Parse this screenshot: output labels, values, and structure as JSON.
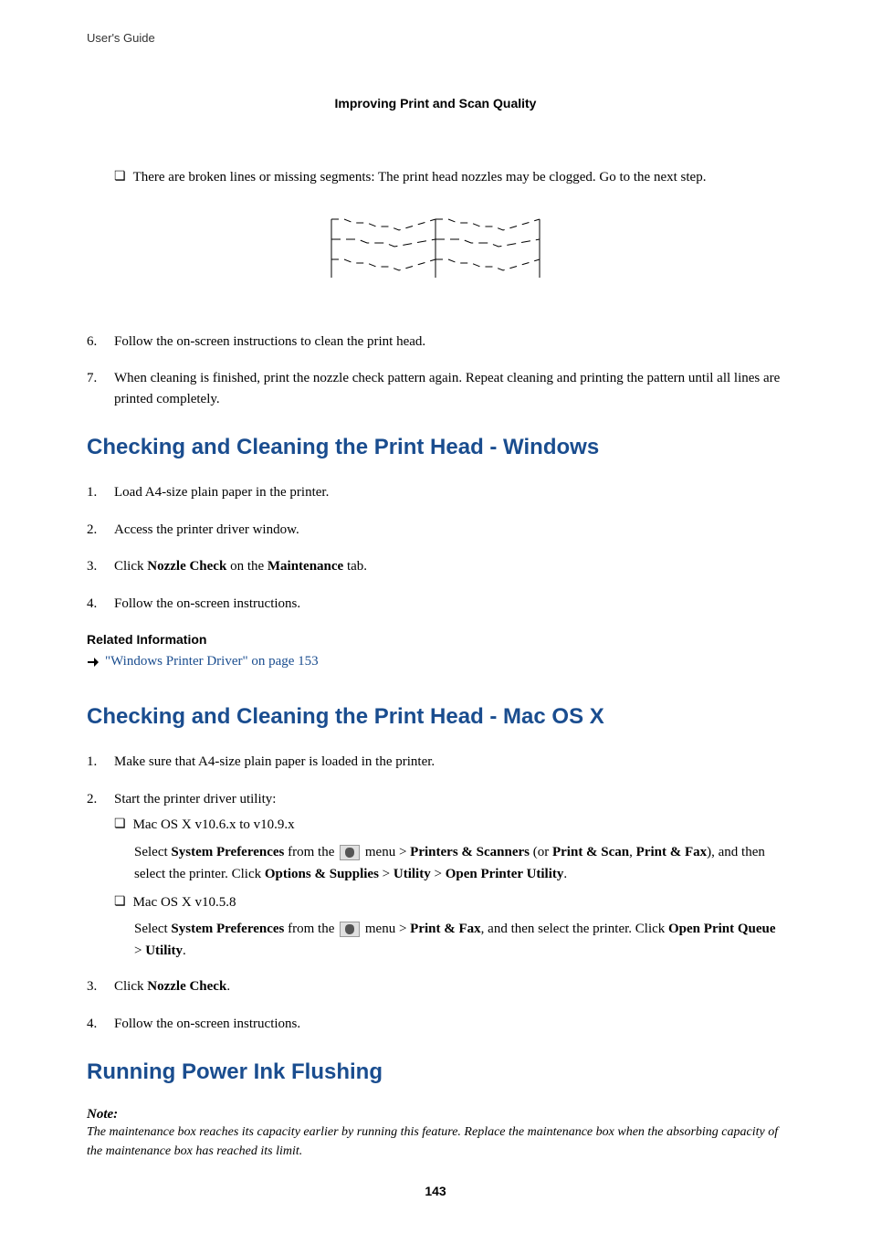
{
  "guide_label": "User's Guide",
  "section_header": "Improving Print and Scan Quality",
  "broken_lines_bullet": "There are broken lines or missing segments: The print head nozzles may be clogged. Go to the next step.",
  "step6_num": "6.",
  "step6_text": "Follow the on-screen instructions to clean the print head.",
  "step7_num": "7.",
  "step7_text": "When cleaning is finished, print the nozzle check pattern again. Repeat cleaning and printing the pattern until all lines are printed completely.",
  "h2_windows": "Checking and Cleaning the Print Head - Windows",
  "win_step1_num": "1.",
  "win_step1_text": "Load A4-size plain paper in the printer.",
  "win_step2_num": "2.",
  "win_step2_text": "Access the printer driver window.",
  "win_step3_num": "3.",
  "win_step3_prefix": "Click ",
  "win_step3_bold1": "Nozzle Check",
  "win_step3_mid": " on the ",
  "win_step3_bold2": "Maintenance",
  "win_step3_suffix": " tab.",
  "win_step4_num": "4.",
  "win_step4_text": "Follow the on-screen instructions.",
  "related_heading": "Related Information",
  "related_link": "\"Windows Printer Driver\" on page 153",
  "h2_mac": "Checking and Cleaning the Print Head - Mac OS X",
  "mac_step1_num": "1.",
  "mac_step1_text": "Make sure that A4-size plain paper is loaded in the printer.",
  "mac_step2_num": "2.",
  "mac_step2_text": "Start the printer driver utility:",
  "mac_sub1_label": "Mac OS X v10.6.x to v10.9.x",
  "mac_sub1_p1_select": "Select ",
  "mac_sub1_p1_syspref": "System Preferences",
  "mac_sub1_p1_fromthe": " from the ",
  "mac_sub1_p1_menu": " menu > ",
  "mac_sub1_p1_ps": "Printers & Scanners",
  "mac_sub1_p1_or": " (or ",
  "mac_sub1_p1_pscan": "Print & Scan",
  "mac_sub1_p1_comma": ", ",
  "mac_sub1_p1_pfax": "Print & Fax",
  "mac_sub1_p1_andthen": "), and then select the printer. Click ",
  "mac_sub1_p1_os": "Options & Supplies",
  "mac_sub1_p1_gt1": " > ",
  "mac_sub1_p1_util": "Utility",
  "mac_sub1_p1_gt2": " > ",
  "mac_sub1_p1_opu": "Open Printer Utility",
  "mac_sub1_p1_period": ".",
  "mac_sub2_label": "Mac OS X v10.5.8",
  "mac_sub2_p1_select": "Select ",
  "mac_sub2_p1_syspref": "System Preferences",
  "mac_sub2_p1_fromthe": " from the ",
  "mac_sub2_p1_menu": " menu > ",
  "mac_sub2_p1_pfax": "Print & Fax",
  "mac_sub2_p1_andthen": ", and then select the printer. Click ",
  "mac_sub2_p1_opq": "Open Print Queue",
  "mac_sub2_p1_gt": " > ",
  "mac_sub2_p1_util": "Utility",
  "mac_sub2_p1_period": ".",
  "mac_step3_num": "3.",
  "mac_step3_prefix": "Click ",
  "mac_step3_bold": "Nozzle Check",
  "mac_step3_suffix": ".",
  "mac_step4_num": "4.",
  "mac_step4_text": "Follow the on-screen instructions.",
  "h2_flush": "Running Power Ink Flushing",
  "note_label": "Note:",
  "note_text": "The maintenance box reaches its capacity earlier by running this feature. Replace the maintenance box when the absorbing capacity of the maintenance box has reached its limit.",
  "page_num": "143"
}
